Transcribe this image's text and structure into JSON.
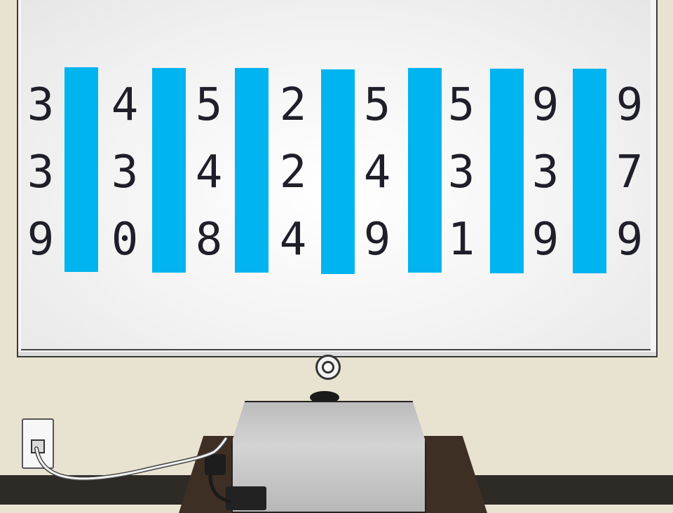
{
  "scene": {
    "stripe_color": "#00b4f0",
    "digit_columns": [
      [
        "3",
        "3",
        "9"
      ],
      [
        "4",
        "3",
        "0"
      ],
      [
        "5",
        "4",
        "8"
      ],
      [
        "2",
        "2",
        "4"
      ],
      [
        "5",
        "4",
        "9"
      ],
      [
        "5",
        "3",
        "1"
      ],
      [
        "9",
        "3",
        "9"
      ],
      [
        "9",
        "7",
        "9"
      ]
    ],
    "stripe_count": 7,
    "icons": {
      "projector": "projector-icon",
      "lens": "lens-icon",
      "outlet": "power-outlet-icon",
      "cable": "power-cable-icon"
    }
  }
}
